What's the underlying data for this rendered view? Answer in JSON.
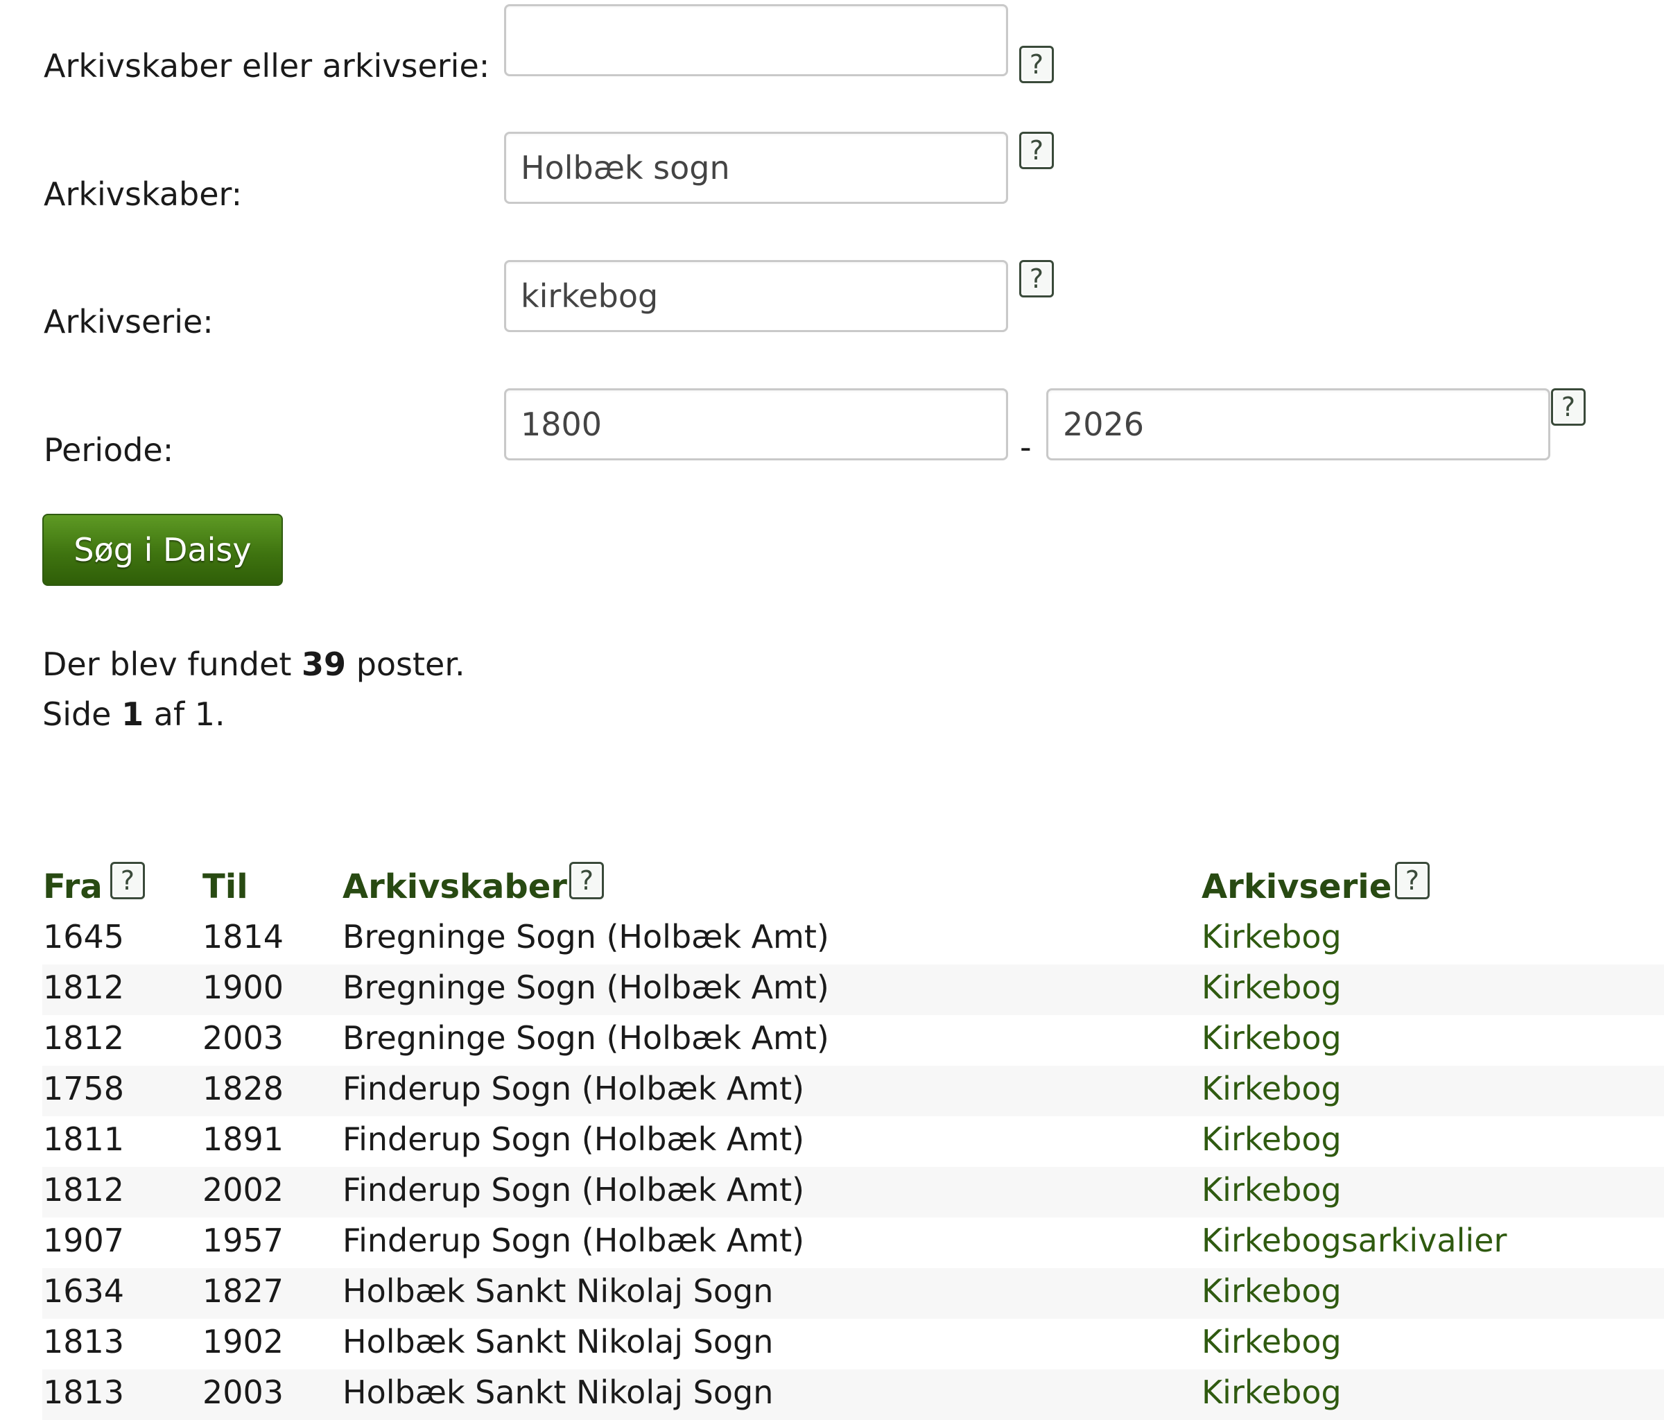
{
  "form": {
    "creator_or_series": {
      "label": "Arkivskaber eller arkivserie:",
      "value": ""
    },
    "creator": {
      "label": "Arkivskaber:",
      "value": "Holbæk sogn"
    },
    "series": {
      "label": "Arkivserie:",
      "value": "kirkebog"
    },
    "period": {
      "label": "Periode:",
      "from": "1800",
      "separator": "-",
      "to": "2026"
    },
    "help_symbol": "?",
    "search_button": "Søg i Daisy"
  },
  "results": {
    "found_prefix": "Der blev fundet",
    "found_count": "39",
    "found_suffix": "poster.",
    "page_prefix": "Side",
    "page_current": "1",
    "page_suffix": "af 1."
  },
  "table": {
    "headers": {
      "from": "Fra",
      "to": "Til",
      "creator": "Arkivskaber",
      "series": "Arkivserie"
    },
    "rows": [
      {
        "from": "1645",
        "to": "1814",
        "creator": "Bregninge Sogn (Holbæk Amt)",
        "series": "Kirkebog"
      },
      {
        "from": "1812",
        "to": "1900",
        "creator": "Bregninge Sogn (Holbæk Amt)",
        "series": "Kirkebog"
      },
      {
        "from": "1812",
        "to": "2003",
        "creator": "Bregninge Sogn (Holbæk Amt)",
        "series": "Kirkebog"
      },
      {
        "from": "1758",
        "to": "1828",
        "creator": "Finderup Sogn (Holbæk Amt)",
        "series": "Kirkebog"
      },
      {
        "from": "1811",
        "to": "1891",
        "creator": "Finderup Sogn (Holbæk Amt)",
        "series": "Kirkebog"
      },
      {
        "from": "1812",
        "to": "2002",
        "creator": "Finderup Sogn (Holbæk Amt)",
        "series": "Kirkebog"
      },
      {
        "from": "1907",
        "to": "1957",
        "creator": "Finderup Sogn (Holbæk Amt)",
        "series": "Kirkebogsarkivalier"
      },
      {
        "from": "1634",
        "to": "1827",
        "creator": "Holbæk Sankt Nikolaj Sogn",
        "series": "Kirkebog"
      },
      {
        "from": "1813",
        "to": "1902",
        "creator": "Holbæk Sankt Nikolaj Sogn",
        "series": "Kirkebog"
      },
      {
        "from": "1813",
        "to": "2003",
        "creator": "Holbæk Sankt Nikolaj Sogn",
        "series": "Kirkebog"
      }
    ]
  },
  "colors": {
    "header_text": "#284a12",
    "link": "#2f5a10",
    "button": "#3f7410",
    "row_alt": "#f7f7f7"
  }
}
